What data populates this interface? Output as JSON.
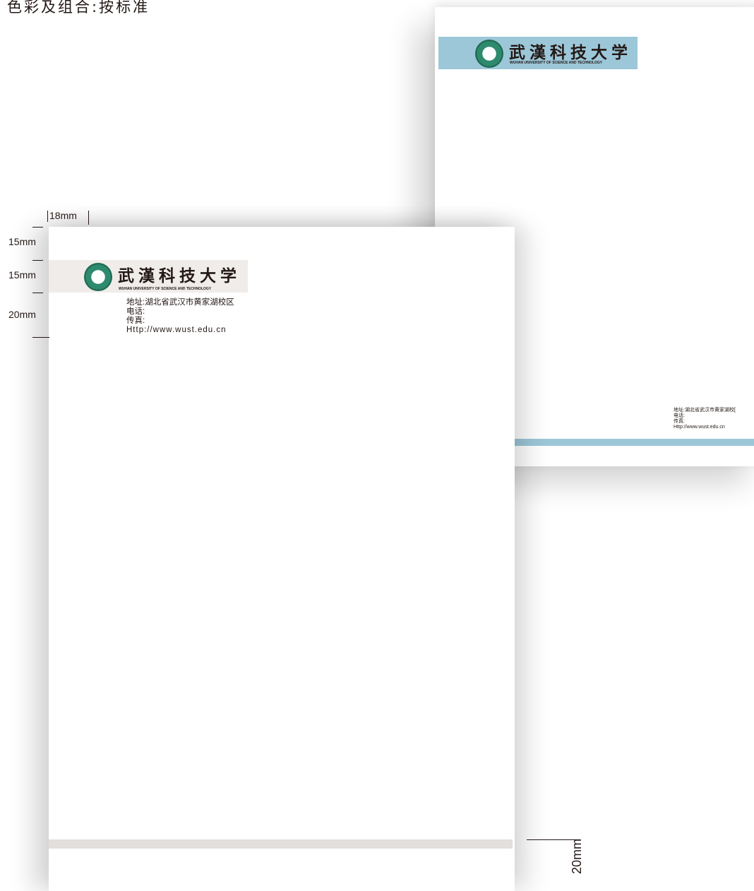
{
  "heading": "色彩及组合:按标准",
  "logo": {
    "name_cn": "武漢科技大学",
    "name_en": "WUHAN UNIVERSITY OF SCIENCE AND TECHNOLOGY"
  },
  "contact": {
    "address": "地址:湖北省武汉市黄家湖校区",
    "phone": "电话:",
    "fax": "传真:",
    "website": "Http://www.wust.edu.cn"
  },
  "back_contact": {
    "address": "地址:湖北省武汉市黄家湖校[",
    "phone": "电话:",
    "fax": "传真:",
    "website": "Http://www.wust.edu.cn"
  },
  "dimensions": {
    "left_margin": "18mm",
    "top_margin": "15mm",
    "logo_height": "15mm",
    "info_height": "20mm",
    "bottom_margin": "20mm"
  },
  "colors": {
    "back_band": "#9cc7d8",
    "front_band": "#efecea",
    "front_footer": "#e2dfdd",
    "emblem_green": "#2e8a6e",
    "text": "#231815"
  },
  "icons": [
    "university-emblem-icon"
  ]
}
